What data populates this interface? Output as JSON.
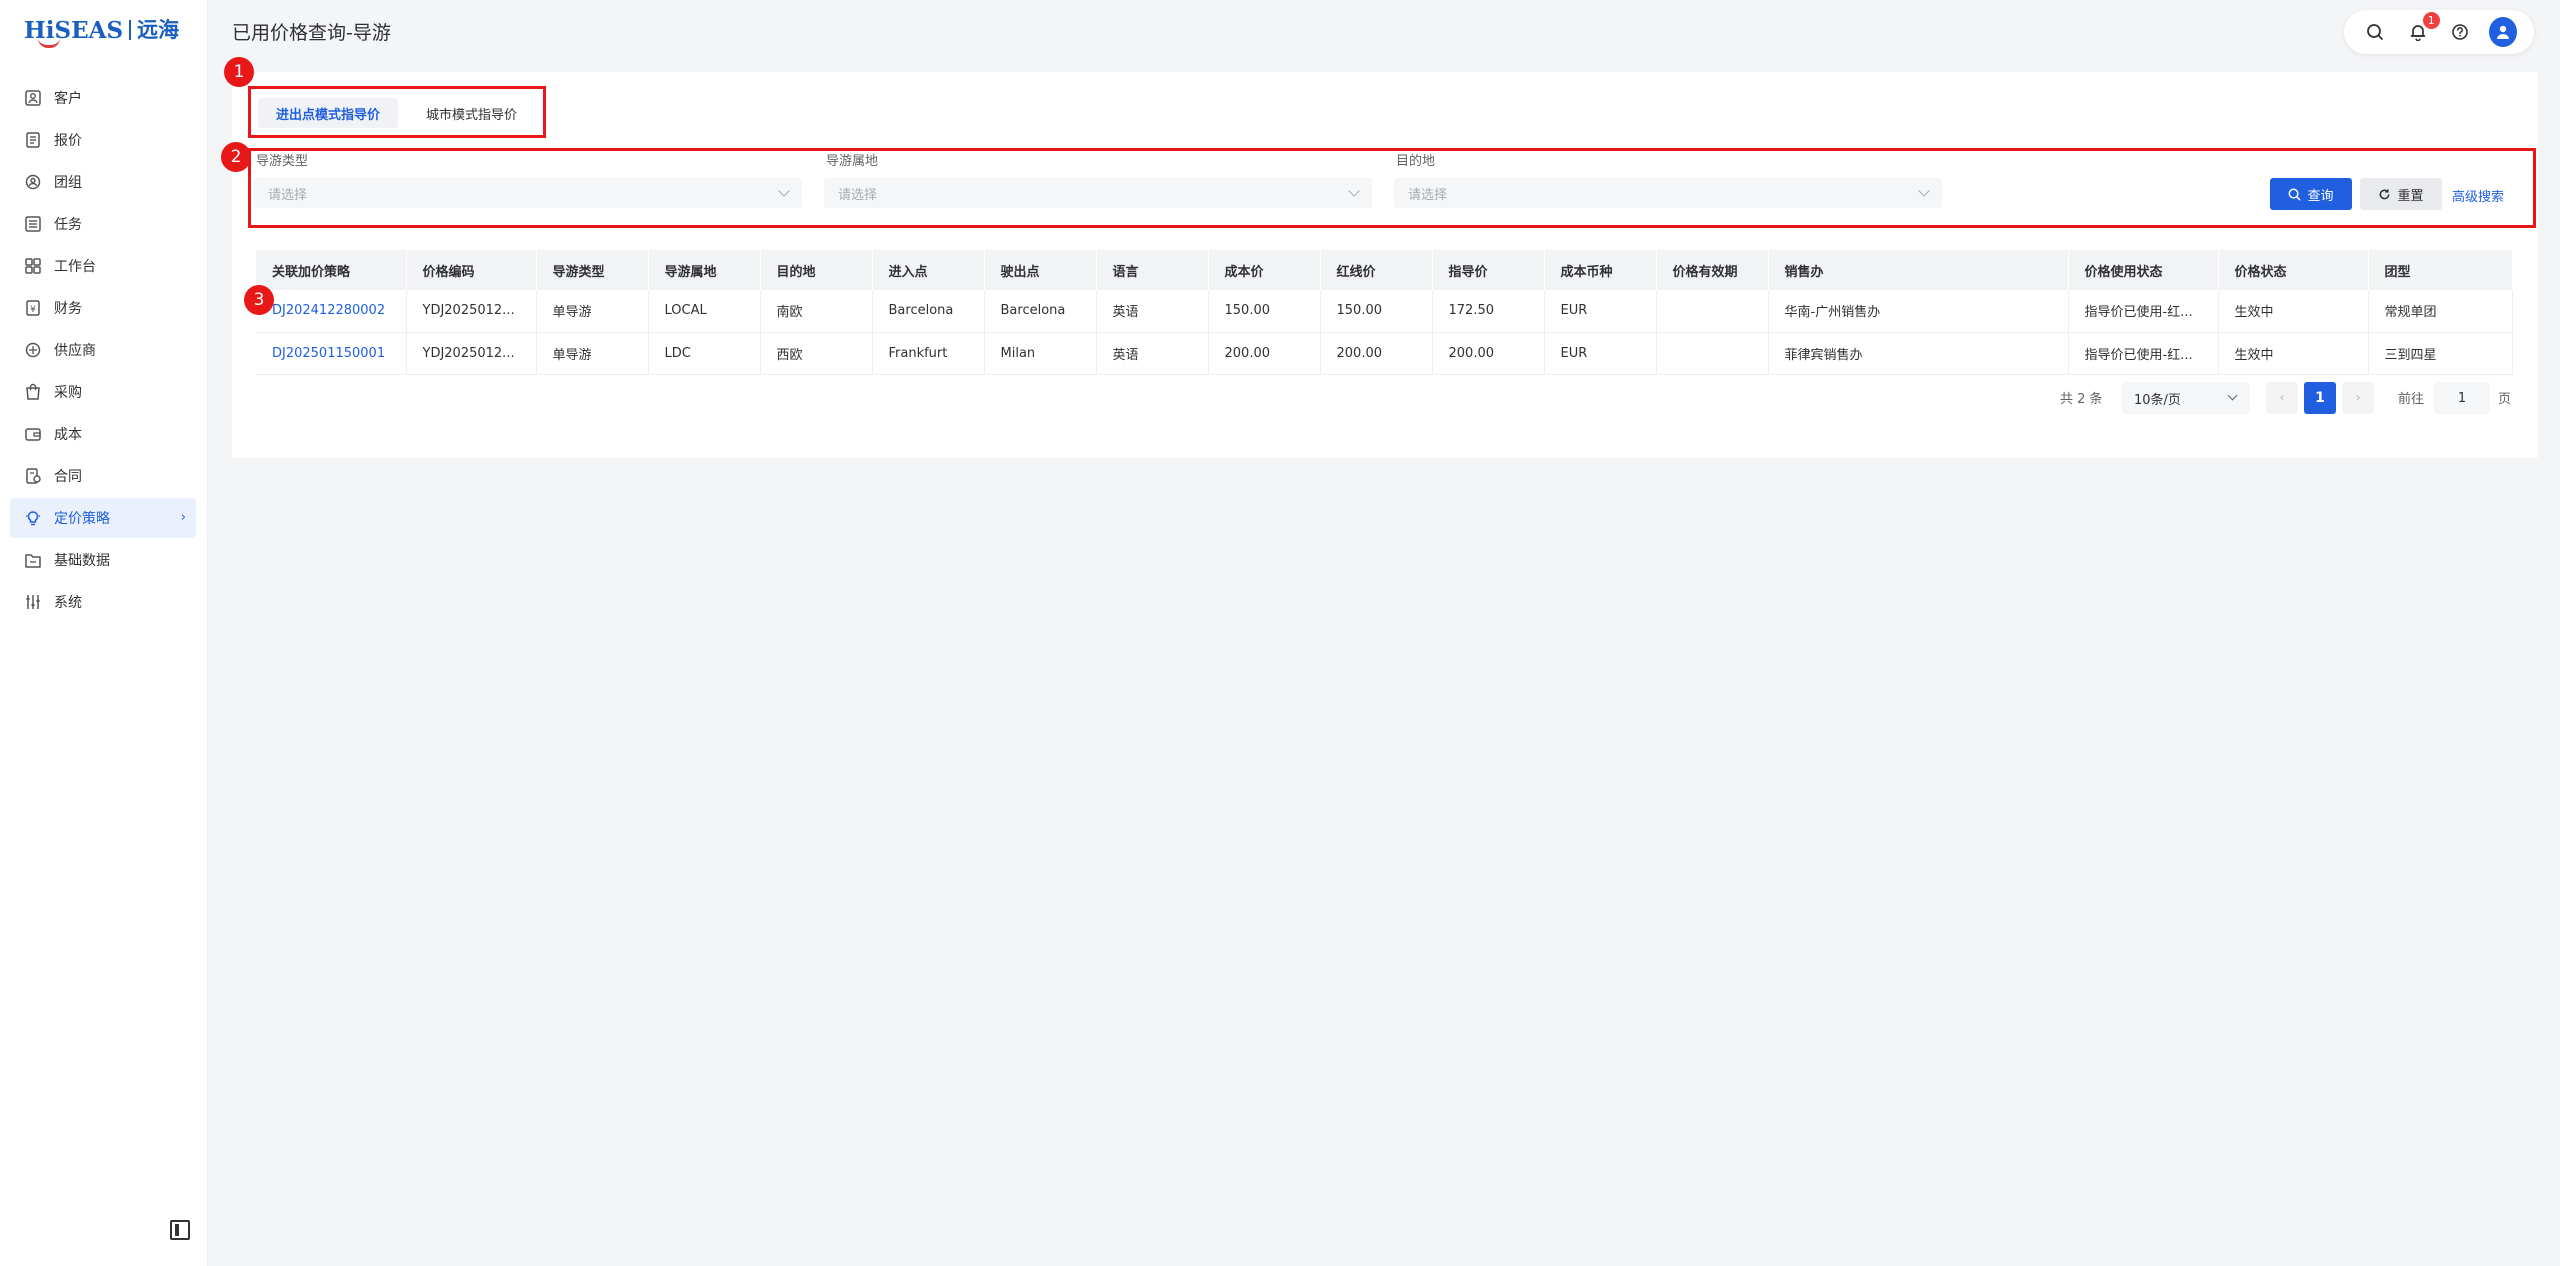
{
  "brand": {
    "logo_text": "HiSEAS",
    "logo_cn": "远海"
  },
  "sidebar": {
    "items": [
      {
        "label": "客户",
        "icon": "customer-icon"
      },
      {
        "label": "报价",
        "icon": "quote-icon"
      },
      {
        "label": "团组",
        "icon": "group-icon"
      },
      {
        "label": "任务",
        "icon": "task-icon"
      },
      {
        "label": "工作台",
        "icon": "workbench-icon"
      },
      {
        "label": "财务",
        "icon": "finance-icon"
      },
      {
        "label": "供应商",
        "icon": "supplier-icon"
      },
      {
        "label": "采购",
        "icon": "purchase-icon"
      },
      {
        "label": "成本",
        "icon": "cost-icon"
      },
      {
        "label": "合同",
        "icon": "contract-icon"
      },
      {
        "label": "定价策略",
        "icon": "pricing-icon",
        "active": true
      },
      {
        "label": "基础数据",
        "icon": "basedata-icon"
      },
      {
        "label": "系统",
        "icon": "system-icon"
      }
    ]
  },
  "header": {
    "title": "已用价格查询-导游",
    "notification_count": "1"
  },
  "annotations": [
    "1",
    "2",
    "3"
  ],
  "tabs": [
    {
      "label": "进出点模式指导价",
      "active": true
    },
    {
      "label": "城市模式指导价",
      "active": false
    }
  ],
  "filters": {
    "guide_type": {
      "label": "导游类型",
      "placeholder": "请选择"
    },
    "guide_origin": {
      "label": "导游属地",
      "placeholder": "请选择"
    },
    "destination": {
      "label": "目的地",
      "placeholder": "请选择"
    },
    "query_label": "查询",
    "reset_label": "重置",
    "advanced_label": "高级搜索"
  },
  "table": {
    "columns": [
      "关联加价策略",
      "价格编码",
      "导游类型",
      "导游属地",
      "目的地",
      "进入点",
      "驶出点",
      "语言",
      "成本价",
      "红线价",
      "指导价",
      "成本币种",
      "价格有效期",
      "销售办",
      "价格使用状态",
      "价格状态",
      "团型"
    ],
    "rows": [
      [
        "DJ202412280002",
        "YDJ2025012...",
        "单导游",
        "LOCAL",
        "南欧",
        "Barcelona",
        "Barcelona",
        "英语",
        "150.00",
        "150.00",
        "172.50",
        "EUR",
        "",
        "华南-广州销售办",
        "指导价已使用-红...",
        "生效中",
        "常规单团"
      ],
      [
        "DJ202501150001",
        "YDJ2025012...",
        "单导游",
        "LDC",
        "西欧",
        "Frankfurt",
        "Milan",
        "英语",
        "200.00",
        "200.00",
        "200.00",
        "EUR",
        "",
        "菲律宾销售办",
        "指导价已使用-红...",
        "生效中",
        "三到四星"
      ]
    ]
  },
  "pagination": {
    "total_text": "共 2 条",
    "page_size": "10条/页",
    "current_page": "1",
    "goto_label": "前往",
    "goto_value": "1",
    "unit": "页",
    "prev": "‹",
    "next": "›"
  }
}
